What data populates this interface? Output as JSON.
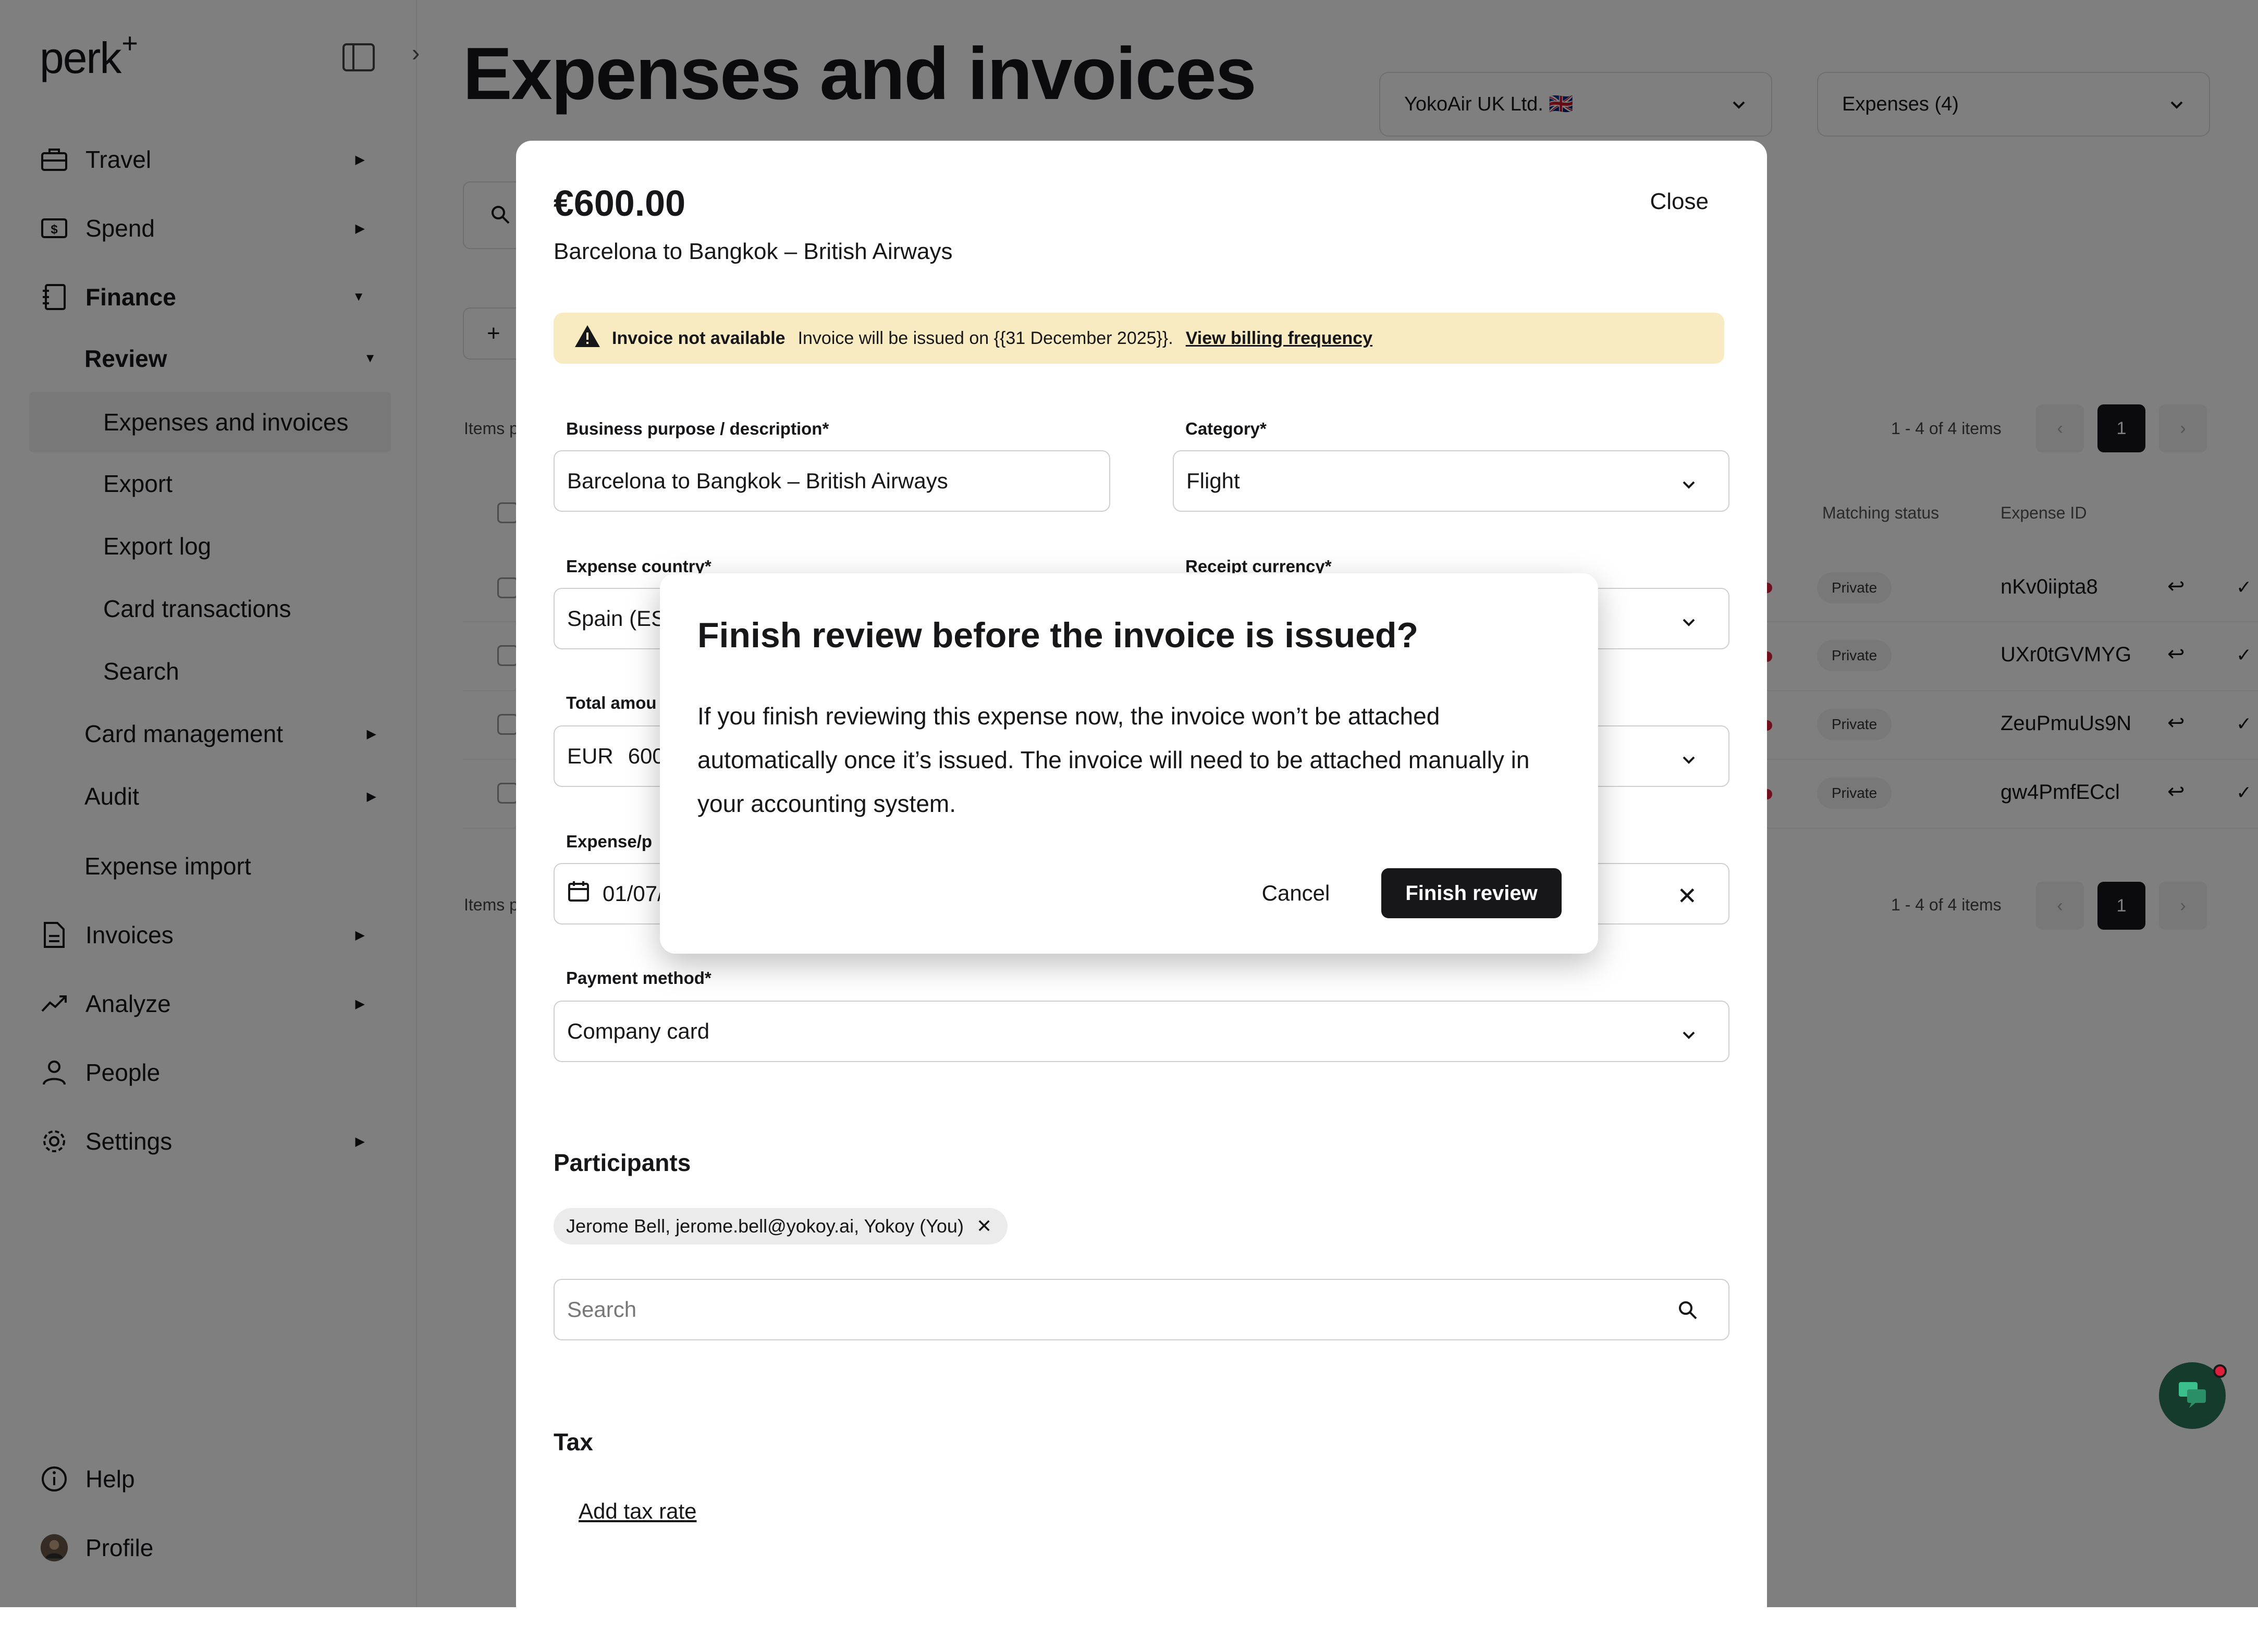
{
  "app": {
    "logo_text": "perk",
    "logo_mark": "+",
    "page_title": "Expenses and invoices"
  },
  "sidebar": {
    "items": [
      {
        "label": "Travel",
        "icon": "briefcase-icon"
      },
      {
        "label": "Spend",
        "icon": "money-icon"
      },
      {
        "label": "Finance",
        "icon": "ledger-icon"
      },
      {
        "label": "Invoices",
        "icon": "document-icon"
      },
      {
        "label": "Analyze",
        "icon": "trend-icon"
      },
      {
        "label": "People",
        "icon": "person-icon"
      },
      {
        "label": "Settings",
        "icon": "gear-icon"
      }
    ],
    "finance_sub": {
      "review": "Review",
      "review_items": [
        "Expenses and invoices",
        "Export",
        "Export log",
        "Card transactions",
        "Search"
      ],
      "card_management": "Card management",
      "audit": "Audit",
      "expense_import": "Expense import"
    },
    "help": "Help",
    "profile": "Profile"
  },
  "header": {
    "entity_select": "YokoAir UK Ltd. 🇬🇧",
    "view_select": "Expenses (4)"
  },
  "table": {
    "items_label": "Items p",
    "pagination_text": "1 - 4 of 4 items",
    "current_page": "1",
    "prev_glyph": "‹",
    "next_glyph": "›",
    "columns": [
      "Matching status",
      "Expense ID"
    ],
    "rows": [
      {
        "status": "Private",
        "id": "nKv0iipta8"
      },
      {
        "status": "Private",
        "id": "UXr0tGVMYG"
      },
      {
        "status": "Private",
        "id": "ZeuPmuUs9N"
      },
      {
        "status": "Private",
        "id": "gw4PmfECcl"
      }
    ]
  },
  "drawer": {
    "amount": "€600.00",
    "subtitle": "Barcelona to Bangkok – British Airways",
    "close_label": "Close",
    "banner": {
      "title": "Invoice not available",
      "text": "Invoice will be issued on {{31 December 2025}}.",
      "link": "View billing frequency"
    },
    "fields": {
      "business_purpose_label": "Business purpose / description*",
      "business_purpose_value": "Barcelona to Bangkok – British Airways",
      "category_label": "Category*",
      "category_value": "Flight",
      "expense_country_label": "Expense country*",
      "expense_country_value": "Spain (ES",
      "receipt_currency_label": "Receipt currency*",
      "total_amount_label": "Total amou",
      "total_amount_currency": "EUR",
      "total_amount_value": "600",
      "expense_date_label": "Expense/p",
      "expense_date_value": "01/07/",
      "payment_method_label": "Payment method*",
      "payment_method_value": "Company card"
    },
    "participants_title": "Participants",
    "participant_chip": "Jerome Bell, jerome.bell@yokoy.ai, Yokoy (You)",
    "search_placeholder": "Search",
    "tax_title": "Tax",
    "add_tax_rate": "Add tax rate"
  },
  "dialog": {
    "title": "Finish review before the invoice is issued?",
    "body": "If you finish reviewing this expense now, the invoice won’t be attached automatically once it’s issued. The invoice will need to be attached manually in your accounting system.",
    "cancel_label": "Cancel",
    "confirm_label": "Finish review"
  }
}
